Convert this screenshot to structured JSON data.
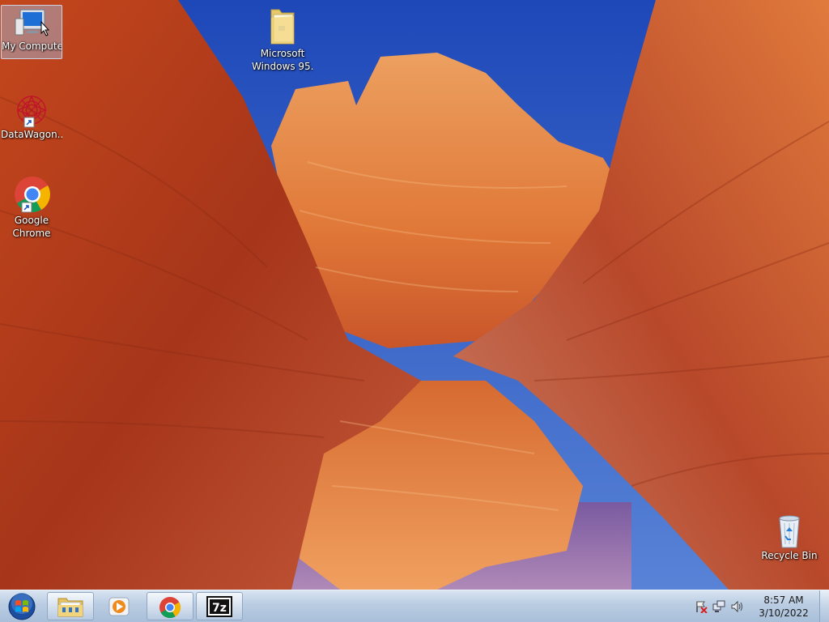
{
  "desktop": {
    "icons": [
      {
        "label": "My Computer",
        "icon": "computer-icon"
      },
      {
        "label": "Microsoft Windows 95...",
        "label_line1": "Microsoft",
        "label_line2": "Windows 95...",
        "icon": "folder-icon"
      },
      {
        "label": "DataWagon...",
        "icon": "datawagon-icon"
      },
      {
        "label": "Google Chrome",
        "label_line1": "Google",
        "label_line2": "Chrome",
        "icon": "chrome-icon"
      },
      {
        "label": "Recycle Bin",
        "icon": "recycle-bin-icon"
      }
    ]
  },
  "taskbar": {
    "pinned": [
      {
        "name": "File Explorer",
        "icon": "folder-icon"
      },
      {
        "name": "Windows Media Player",
        "icon": "media-player-icon"
      },
      {
        "name": "Google Chrome",
        "icon": "chrome-icon"
      },
      {
        "name": "7-Zip",
        "icon": "7zip-icon",
        "text": "7z"
      }
    ],
    "tray": {
      "time": "8:57 AM",
      "date": "3/10/2022"
    }
  },
  "colors": {
    "sky": "#2d5cc8",
    "rock": "#d0602a",
    "taskbar": "#b9cce2"
  }
}
